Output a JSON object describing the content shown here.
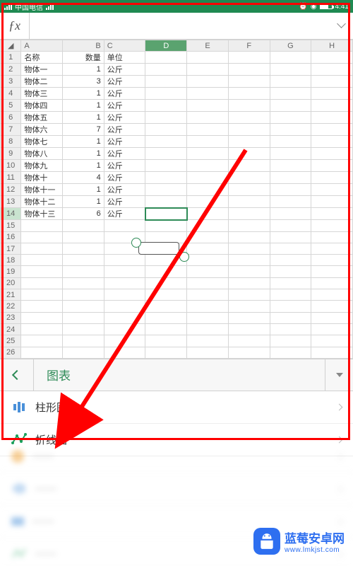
{
  "status": {
    "carrier": "中国电信",
    "time": "4:41"
  },
  "fx": {
    "value": ""
  },
  "columns": [
    "A",
    "B",
    "C",
    "D",
    "E",
    "F",
    "G",
    "H"
  ],
  "selected_column": "D",
  "selected_row": 14,
  "headers": {
    "A": "名称",
    "B": "数量",
    "C": "单位"
  },
  "rows": [
    {
      "A": "物体一",
      "B": 1,
      "C": "公斤"
    },
    {
      "A": "物体二",
      "B": 3,
      "C": "公斤"
    },
    {
      "A": "物体三",
      "B": 1,
      "C": "公斤"
    },
    {
      "A": "物体四",
      "B": 1,
      "C": "公斤"
    },
    {
      "A": "物体五",
      "B": 1,
      "C": "公斤"
    },
    {
      "A": "物体六",
      "B": 7,
      "C": "公斤"
    },
    {
      "A": "物体七",
      "B": 1,
      "C": "公斤"
    },
    {
      "A": "物体八",
      "B": 1,
      "C": "公斤"
    },
    {
      "A": "物体九",
      "B": 1,
      "C": "公斤"
    },
    {
      "A": "物体十",
      "B": 4,
      "C": "公斤"
    },
    {
      "A": "物体十一",
      "B": 1,
      "C": "公斤"
    },
    {
      "A": "物体十二",
      "B": 1,
      "C": "公斤"
    },
    {
      "A": "物体十三",
      "B": 6,
      "C": "公斤"
    }
  ],
  "blank_rows_from": 15,
  "blank_rows_to": 26,
  "ribbon": {
    "title": "图表"
  },
  "menu": {
    "items": [
      {
        "id": "bar",
        "label": "柱形图",
        "icon": "bar-chart-icon"
      },
      {
        "id": "line",
        "label": "折线图",
        "icon": "line-chart-icon"
      }
    ]
  },
  "watermark": {
    "text": "蓝莓安卓网",
    "url_label": "www.lmkjst.com"
  },
  "chart_data": {
    "type": "table",
    "title": "",
    "columns": [
      "名称",
      "数量",
      "单位"
    ],
    "rows": [
      [
        "物体一",
        1,
        "公斤"
      ],
      [
        "物体二",
        3,
        "公斤"
      ],
      [
        "物体三",
        1,
        "公斤"
      ],
      [
        "物体四",
        1,
        "公斤"
      ],
      [
        "物体五",
        1,
        "公斤"
      ],
      [
        "物体六",
        7,
        "公斤"
      ],
      [
        "物体七",
        1,
        "公斤"
      ],
      [
        "物体八",
        1,
        "公斤"
      ],
      [
        "物体九",
        1,
        "公斤"
      ],
      [
        "物体十",
        4,
        "公斤"
      ],
      [
        "物体十一",
        1,
        "公斤"
      ],
      [
        "物体十二",
        1,
        "公斤"
      ],
      [
        "物体十三",
        6,
        "公斤"
      ]
    ]
  }
}
